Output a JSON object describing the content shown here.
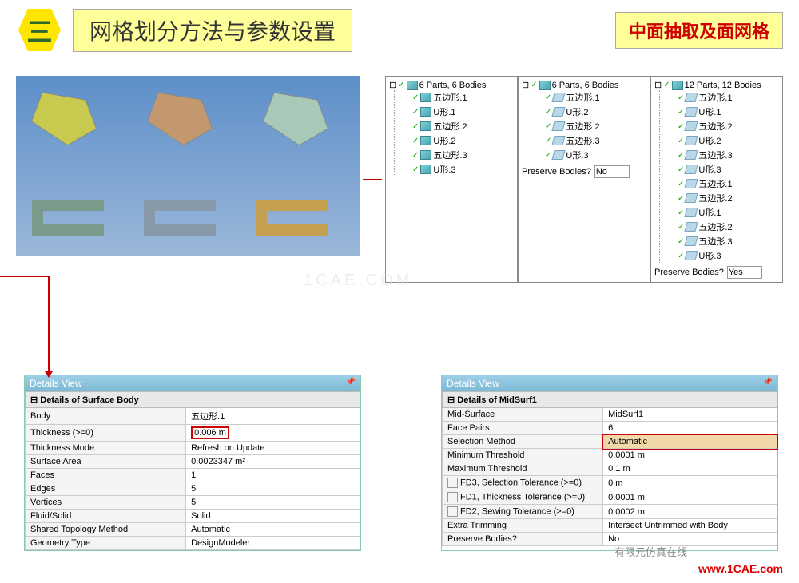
{
  "header": {
    "num": "三",
    "title": "网格划分方法与参数设置",
    "right": "中面抽取及面网格"
  },
  "trees": {
    "t1": {
      "root": "6 Parts, 6 Bodies",
      "items": [
        "五边形.1",
        "U形.1",
        "五边形.2",
        "U形.2",
        "五边形.3",
        "U形.3"
      ]
    },
    "t2": {
      "root": "6 Parts, 6 Bodies",
      "items": [
        "五边形.1",
        "U形.2",
        "五边形.2",
        "五边形.3",
        "U形.3"
      ],
      "preserve_lbl": "Preserve Bodies?",
      "preserve_val": "No"
    },
    "t3": {
      "root": "12 Parts, 12 Bodies",
      "items": [
        "五边形.1",
        "U形.1",
        "五边形.2",
        "U形.2",
        "五边形.3",
        "U形.3",
        "五边形.1",
        "五边形.2",
        "U形.1",
        "五边形.2",
        "五边形.3",
        "U形.3"
      ],
      "preserve_lbl": "Preserve Bodies?",
      "preserve_val": "Yes"
    }
  },
  "dv1": {
    "title": "Details View",
    "section": "Details of Surface Body",
    "rows": [
      {
        "k": "Body",
        "v": "五边形.1"
      },
      {
        "k": "Thickness (>=0)",
        "v": "0.006 m",
        "hl": true
      },
      {
        "k": "Thickness Mode",
        "v": "Refresh on Update"
      },
      {
        "k": "Surface Area",
        "v": "0.0023347 m²"
      },
      {
        "k": "Faces",
        "v": "1"
      },
      {
        "k": "Edges",
        "v": "5"
      },
      {
        "k": "Vertices",
        "v": "5"
      },
      {
        "k": "Fluid/Solid",
        "v": "Solid"
      },
      {
        "k": "Shared Topology Method",
        "v": "Automatic"
      },
      {
        "k": "Geometry Type",
        "v": "DesignModeler"
      }
    ]
  },
  "dv2": {
    "title": "Details View",
    "section": "Details of MidSurf1",
    "rows": [
      {
        "k": "Mid-Surface",
        "v": "MidSurf1"
      },
      {
        "k": "Face Pairs",
        "v": "6"
      },
      {
        "k": "Selection Method",
        "v": "Automatic",
        "hl2": true
      },
      {
        "k": "Minimum Threshold",
        "v": "0.0001 m"
      },
      {
        "k": "Maximum Threshold",
        "v": "0.1 m"
      },
      {
        "k": "FD3, Selection Tolerance (>=0)",
        "v": "0 m",
        "cb": true
      },
      {
        "k": "FD1, Thickness Tolerance (>=0)",
        "v": "0.0001 m",
        "cb": true
      },
      {
        "k": "FD2, Sewing Tolerance (>=0)",
        "v": "0.0002 m",
        "cb": true
      },
      {
        "k": "Extra Trimming",
        "v": "Intersect Untrimmed with Body"
      },
      {
        "k": "Preserve Bodies?",
        "v": "No"
      }
    ]
  },
  "footer": {
    "note": "有限元仿真在线",
    "url": "www.1CAE.com",
    "wm": "1CAE.COM"
  }
}
